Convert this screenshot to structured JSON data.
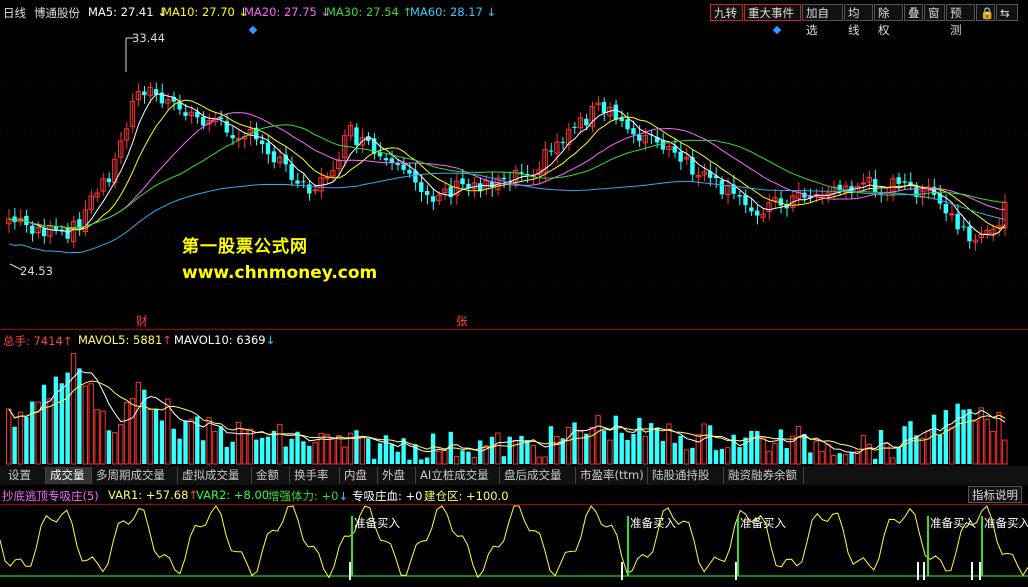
{
  "header": {
    "period": "日线",
    "stock_name": "博通股份",
    "ma": [
      {
        "label": "MA5: 27.41",
        "arrow": "↓",
        "color": "#ffffff"
      },
      {
        "label": "MA10: 27.70",
        "arrow": "↓",
        "color": "#ffff00"
      },
      {
        "label": "MA20: 27.75",
        "arrow": "↓",
        "color": "#ff66ff"
      },
      {
        "label": "MA30: 27.54",
        "arrow": "↑",
        "color": "#33dd33"
      },
      {
        "label": "MA60: 28.17",
        "arrow": "↓",
        "color": "#33ccff"
      }
    ],
    "toolbar": [
      "九转",
      "重大事件",
      "加自选",
      "均线",
      "除权",
      "叠",
      "窗",
      "预测",
      "🔒",
      "⇆"
    ]
  },
  "price_chart": {
    "high_label": "33.44",
    "low_label": "24.53",
    "markers": [
      "财",
      "张"
    ]
  },
  "watermark": {
    "line1": "第一股票公式网",
    "line2": "www.chnmoney.com"
  },
  "volume": {
    "total_label": "总手: 7414",
    "total_arrow": "↑",
    "mavol5_label": "MAVOL5: 5881",
    "mavol5_arrow": "↑",
    "mavol10_label": "MAVOL10: 6369",
    "mavol10_arrow": "↓"
  },
  "tabs": [
    "设置",
    "成交量",
    "多周期成交量",
    "虚拟成交量",
    "金额",
    "换手率",
    "内盘",
    "外盘",
    "AI立桩成交量",
    "盘后成交量",
    "市盈率(ttm)",
    "陆股通持股",
    "融资融券余额"
  ],
  "active_tab": 1,
  "indicator": {
    "name": "抄底逃顶专吸庄(5)",
    "var1": "VAR1: +57.68",
    "var1_arrow": "↑",
    "var2": "VAR2: +8.00",
    "zqtl": "增强体力: +0",
    "zqtl_arrow": "↓",
    "zxzx": "专吸庄血: +0",
    "jcq": "建仓区: +100.0",
    "help_button": "指标说明",
    "buy_label": "准备买入"
  },
  "colors": {
    "up": "#ff3333",
    "down": "#33ffff",
    "bg": "#000000",
    "border": "#aa0000"
  }
}
